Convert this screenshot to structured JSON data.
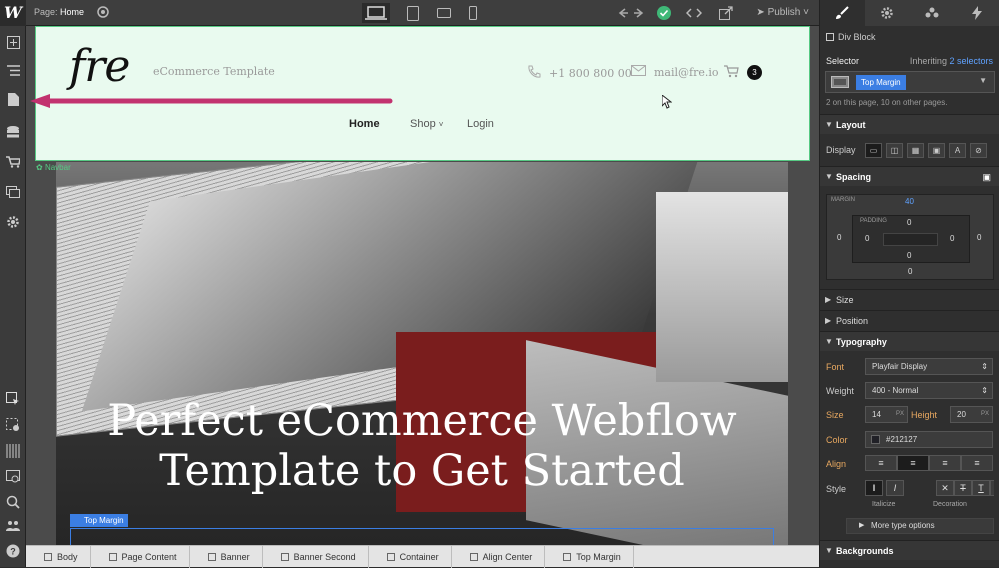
{
  "app": {
    "logo": "W"
  },
  "left_toolbar": {
    "items": [
      "add-panel",
      "navigator",
      "pages",
      "cms",
      "ecommerce",
      "assets",
      "settings",
      "select",
      "audit",
      "grid",
      "preview",
      "search",
      "help"
    ]
  },
  "top_bar": {
    "page_label": "Page:",
    "page_name": "Home",
    "publish_label": "Publish"
  },
  "site": {
    "logo_text": "fre",
    "logo_subtitle": "eCommerce Template",
    "phone": "+1 800 800 00",
    "email": "mail@fre.io",
    "cart_count": "3",
    "nav": {
      "home": "Home",
      "shop": "Shop",
      "login": "Login"
    },
    "navbar_tag": "Navbar",
    "hero_title_line1": "Perfect eCommerce Webflow",
    "hero_title_line2": "Template to Get Started",
    "top_margin_tag": "Top Margin"
  },
  "breadcrumb": [
    "Body",
    "Page Content",
    "Banner",
    "Banner Second",
    "Container",
    "Align Center",
    "Top Margin"
  ],
  "right_panel": {
    "element_type": "Div Block",
    "selector_label": "Selector",
    "inheriting_text": "Inheriting",
    "inheriting_count": "2 selectors",
    "selector_chip": "Top Margin",
    "selector_info": "2 on this page, 10 on other pages.",
    "layout": {
      "title": "Layout",
      "display_label": "Display"
    },
    "spacing": {
      "title": "Spacing",
      "margin_label": "MARGIN",
      "padding_label": "PADDING",
      "margin_top": "40",
      "margin_right": "0",
      "margin_bottom": "0",
      "margin_left": "0",
      "padding_top": "0",
      "padding_right": "0",
      "padding_bottom": "0",
      "padding_left": "0"
    },
    "size_title": "Size",
    "position_title": "Position",
    "typography": {
      "title": "Typography",
      "font_label": "Font",
      "font_value": "Playfair Display",
      "weight_label": "Weight",
      "weight_value": "400 - Normal",
      "size_label": "Size",
      "size_value": "14",
      "size_unit": "PX",
      "height_label": "Height",
      "height_value": "20",
      "height_unit": "PX",
      "color_label": "Color",
      "color_value": "#212127",
      "align_label": "Align",
      "style_label": "Style",
      "italicize_label": "Italicize",
      "decoration_label": "Decoration",
      "more_options": "More type options"
    },
    "backgrounds_title": "Backgrounds"
  },
  "colors": {
    "accent_blue": "#3b7ee3",
    "navbar_green": "#56c983",
    "arrow_pink": "#c2326f",
    "orange_label": "#e8a860"
  }
}
